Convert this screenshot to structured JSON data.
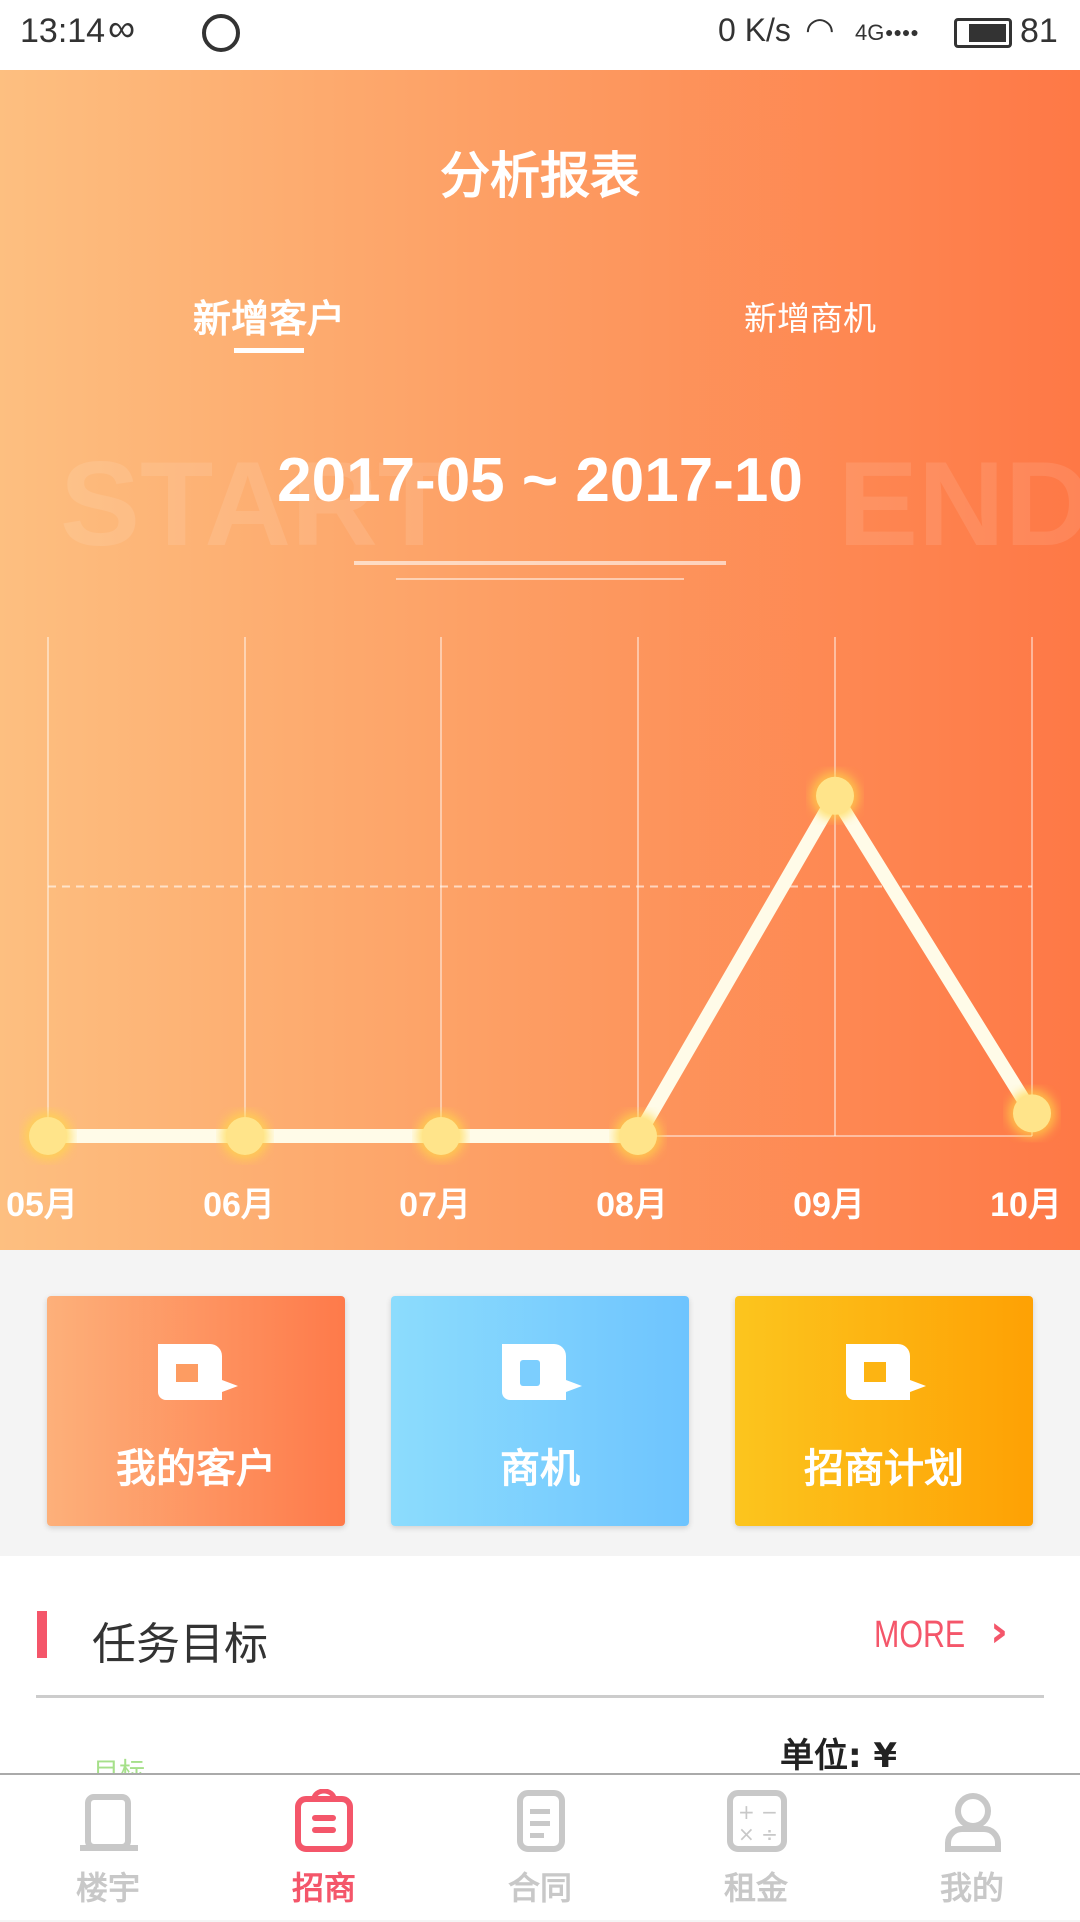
{
  "status_bar": {
    "time": "13:14",
    "net_speed": "0 K/s",
    "network": "4G",
    "battery": "81"
  },
  "header": {
    "title": "分析报表"
  },
  "tabs": [
    {
      "label": "新增客户",
      "active": true
    },
    {
      "label": "新增商机",
      "active": false
    }
  ],
  "date_range": {
    "text": "2017-05 ~ 2017-10",
    "start_watermark": "START",
    "end_watermark": "END"
  },
  "chart_data": {
    "type": "line",
    "categories": [
      "05月",
      "06月",
      "07月",
      "08月",
      "09月",
      "10月"
    ],
    "values": [
      0,
      0,
      0,
      0,
      15,
      1
    ],
    "ylim": [
      0,
      22
    ],
    "reference_line": 11,
    "grid": "vertical",
    "line_color": "#fffbe8",
    "point_color": "#ffe48a"
  },
  "cards": [
    {
      "label": "我的客户",
      "icon": "customer-folder-icon",
      "colors": [
        "#fdb07a",
        "#fe7a4a"
      ]
    },
    {
      "label": "商机",
      "icon": "opportunity-card-icon",
      "colors": [
        "#8cdcfd",
        "#6ec4fe"
      ]
    },
    {
      "label": "招商计划",
      "icon": "plan-calendar-icon",
      "colors": [
        "#fcc51e",
        "#fea104"
      ]
    }
  ],
  "task": {
    "title": "任务目标",
    "more": "MORE",
    "unit": "单位: ¥",
    "legend_target": "目标"
  },
  "colors": {
    "accent": "#f4566a",
    "nav_inactive": "#c8c8c8",
    "target_green": "#a6e08a"
  },
  "nav": [
    {
      "label": "楼宇",
      "icon": "building-icon"
    },
    {
      "label": "招商",
      "icon": "briefcase-icon",
      "active": true
    },
    {
      "label": "合同",
      "icon": "document-icon"
    },
    {
      "label": "租金",
      "icon": "calculator-icon"
    },
    {
      "label": "我的",
      "icon": "user-icon"
    }
  ]
}
